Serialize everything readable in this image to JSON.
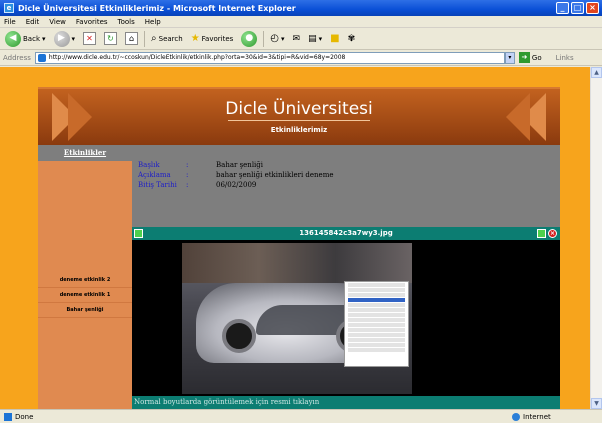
{
  "window": {
    "title": "Dicle Üniversitesi Etkinliklerimiz - Microsoft Internet Explorer"
  },
  "menubar": {
    "items": [
      "File",
      "Edit",
      "View",
      "Favorites",
      "Tools",
      "Help"
    ]
  },
  "toolbar": {
    "back_label": "Back",
    "search_label": "Search",
    "favorites_label": "Favorites"
  },
  "address": {
    "label": "Address",
    "url": "http://www.dicle.edu.tr/~ccoskun/DicleEtkinlik/etkinlik.php?orta=30&id=3&tipi=R&vid=68y=2008",
    "go_label": "Go",
    "links_label": "Links"
  },
  "banner": {
    "title": "Dicle Üniversitesi",
    "subtitle": "Etkinliklerimiz"
  },
  "sidebar": {
    "header": "Etkinlikler",
    "items": [
      "deneme etkinlik 2",
      "deneme etkinlik 1",
      "Bahar şenliği"
    ]
  },
  "details": {
    "rows": [
      {
        "key": "Başlık",
        "colon": ":",
        "value": "Bahar şenliği"
      },
      {
        "key": "Açıklama",
        "colon": ":",
        "value": "bahar şenliği etkinlikleri deneme"
      },
      {
        "key": "Bitiş Tarihi",
        "colon": ":",
        "value": "06/02/2009"
      }
    ]
  },
  "image_viewer": {
    "filename": "136145842c3a7wy3.jpg",
    "caption": "Normal boyutlarda görüntülemek için resmi tıklayın"
  },
  "status": {
    "left": "Done",
    "zone": "Internet"
  },
  "colors": {
    "page_bg": "#f7a41c",
    "teal": "#0c7d72",
    "sidebar": "#e08a50",
    "content_gray": "#7e7e7e"
  }
}
